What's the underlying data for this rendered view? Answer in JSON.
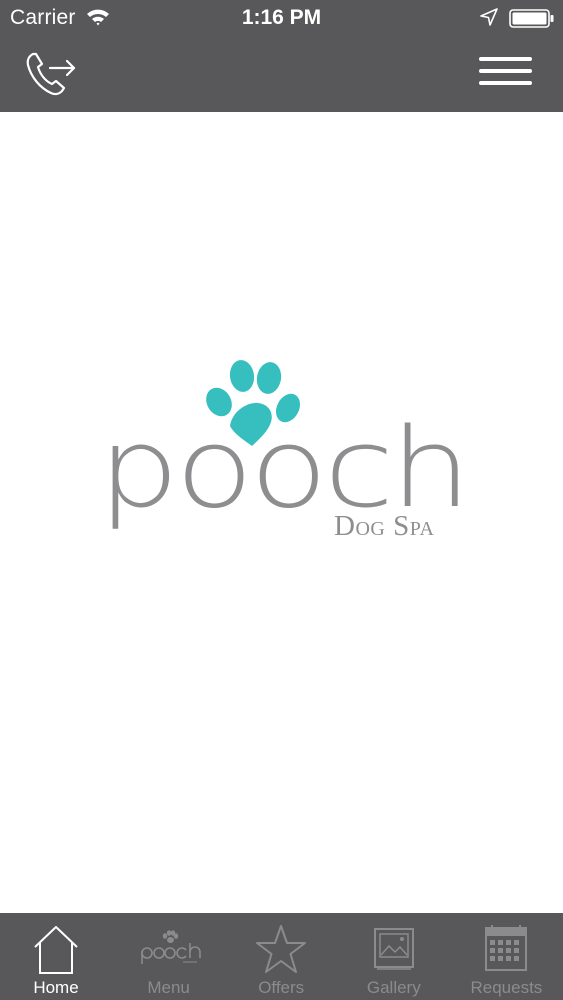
{
  "status_bar": {
    "carrier": "Carrier",
    "time": "1:16 PM"
  },
  "header": {
    "call_icon": "phone-forward-icon",
    "menu_icon": "hamburger-menu-icon"
  },
  "logo": {
    "word": "pooch",
    "tagline": "Dog Spa",
    "paw_color": "#37bfc0",
    "text_color": "#8e8e90"
  },
  "tabbar": {
    "tabs": [
      {
        "label": "Home",
        "icon": "home-icon",
        "active": true
      },
      {
        "label": "Menu",
        "icon": "pooch-logo-icon",
        "active": false
      },
      {
        "label": "Offers",
        "icon": "star-icon",
        "active": false
      },
      {
        "label": "Gallery",
        "icon": "gallery-icon",
        "active": false
      },
      {
        "label": "Requests",
        "icon": "calendar-icon",
        "active": false
      }
    ]
  },
  "colors": {
    "bar_background": "#58585a",
    "active_tab": "#ffffff",
    "inactive_tab": "#8b8b8d"
  }
}
